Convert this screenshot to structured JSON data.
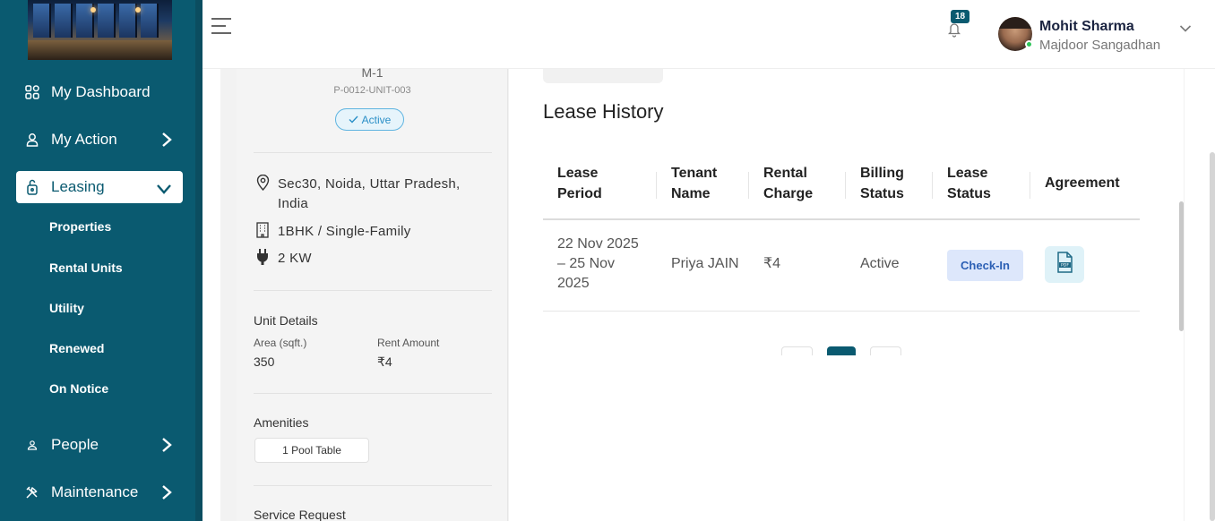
{
  "sidebar": {
    "items": [
      {
        "label": "My Dashboard",
        "icon": "grid-icon"
      },
      {
        "label": "My Action",
        "icon": "user-icon"
      },
      {
        "label": "Leasing",
        "icon": "key-icon"
      },
      {
        "label": "People",
        "icon": "people-icon"
      },
      {
        "label": "Maintenance",
        "icon": "tools-icon"
      }
    ],
    "leasing_sub": [
      "Properties",
      "Rental Units",
      "Utility",
      "Renewed",
      "On Notice"
    ]
  },
  "header": {
    "notification_count": "18",
    "user_name": "Mohit Sharma",
    "user_org": "Majdoor Sangadhan"
  },
  "unit": {
    "name": "M-1",
    "code": "P-0012-UNIT-003",
    "status": "Active",
    "address": "Sec30, Noida, Uttar Pradesh, India",
    "type": "1BHK / Single-Family",
    "power": "2 KW",
    "details_label": "Unit Details",
    "area_label": "Area (sqft.)",
    "area_value": "350",
    "rent_label": "Rent Amount",
    "rent_value": "₹4",
    "amenities_label": "Amenities",
    "amenity": "1 Pool Table",
    "service_label": "Service Request"
  },
  "lease_history": {
    "title": "Lease History",
    "headers": [
      [
        "Lease",
        "Period"
      ],
      [
        "Tenant",
        "Name"
      ],
      [
        "Rental",
        "Charge"
      ],
      [
        "Billing",
        "Status"
      ],
      [
        "Lease",
        "Status"
      ],
      [
        "Agreement"
      ]
    ],
    "row": {
      "period_1": "22 Nov 2025",
      "period_2": "– 25 Nov",
      "period_3": "2025",
      "tenant": "Priya JAIN",
      "charge": "₹4",
      "billing": "Active",
      "lease_status": "Check-In",
      "agreement_icon": "pdf-icon"
    }
  },
  "colors": {
    "brand": "#0a5a70",
    "active_pill": "#2a8fc7",
    "checkin_bg": "#dde7fb"
  }
}
